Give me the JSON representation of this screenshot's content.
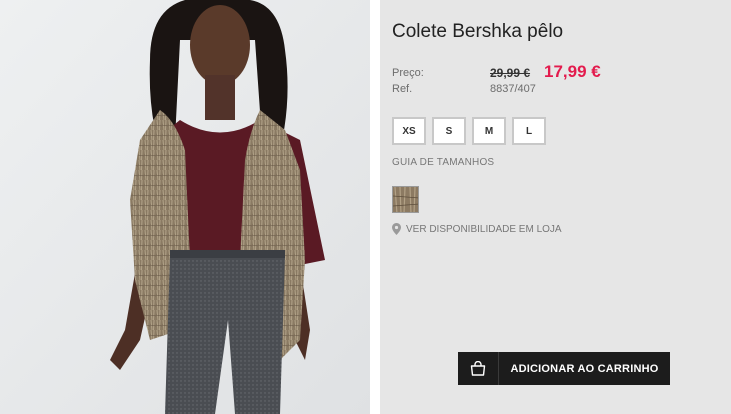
{
  "product": {
    "title": "Colete Bershka pêlo",
    "price_label": "Preço:",
    "old_price": "29,99 €",
    "new_price": "17,99 €",
    "ref_label": "Ref.",
    "ref_value": "8837/407"
  },
  "sizes": [
    "XS",
    "S",
    "M",
    "L"
  ],
  "size_guide": "GUIA DE TAMANHOS",
  "availability": "VER DISPONIBILIDADE EM LOJA",
  "cart_button": "ADICIONAR AO CARRINHO",
  "colors": {
    "sale_price": "#e31b4d",
    "panel_bg": "#e6e6e6",
    "button_bg": "#1c1c1c"
  },
  "icons": {
    "location": "map-pin-icon",
    "cart": "shopping-bag-icon"
  }
}
